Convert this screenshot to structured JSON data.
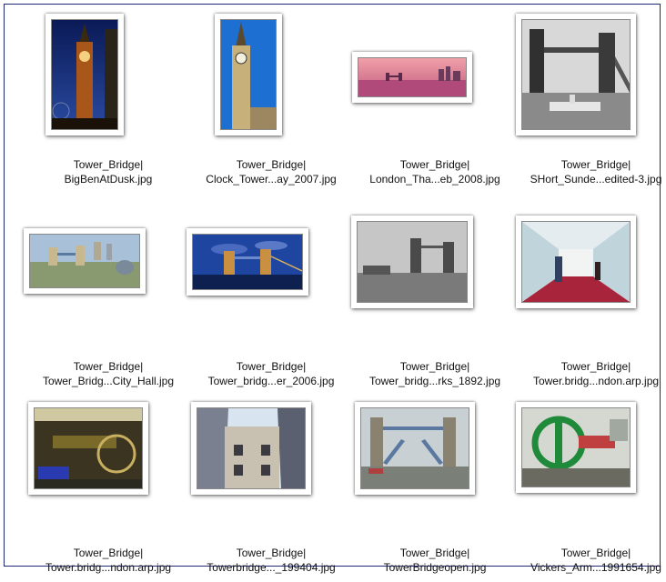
{
  "files": [
    {
      "line1": "Tower_Bridge|",
      "line2": "BigBenAtDusk.jpg",
      "icon": "big-ben-dusk-photo"
    },
    {
      "line1": "Tower_Bridge|",
      "line2": "Clock_Tower...ay_2007.jpg",
      "icon": "clock-tower-photo"
    },
    {
      "line1": "Tower_Bridge|",
      "line2": "London_Tha...eb_2008.jpg",
      "icon": "thames-sunset-photo"
    },
    {
      "line1": "Tower_Bridge|",
      "line2": "SHort_Sunde...edited-3.jpg",
      "icon": "bw-bridge-seaplane-photo"
    },
    {
      "line1": "Tower_Bridge|",
      "line2": "Tower_Bridg...City_Hall.jpg",
      "icon": "bridge-city-hall-photo"
    },
    {
      "line1": "Tower_Bridge|",
      "line2": "Tower_bridg...er_2006.jpg",
      "icon": "bridge-night-photo"
    },
    {
      "line1": "Tower_Bridge|",
      "line2": "Tower_bridg...rks_1892.jpg",
      "icon": "bridge-1892-photo"
    },
    {
      "line1": "Tower_Bridge|",
      "line2": "Tower.bridg...ndon.arp.jpg",
      "icon": "walkway-photo"
    },
    {
      "line1": "Tower_Bridge|",
      "line2": "Tower.bridg...ndon.arp.jpg",
      "icon": "engine-room-photo"
    },
    {
      "line1": "Tower_Bridge|",
      "line2": "Towerbridge..._199404.jpg",
      "icon": "tower-upward-photo"
    },
    {
      "line1": "Tower_Bridge|",
      "line2": "TowerBridgeopen.jpg",
      "icon": "bridge-open-photo"
    },
    {
      "line1": "Tower_Bridge|",
      "line2": "Vickers_Arm...1991654.jpg",
      "icon": "vickers-engine-photo"
    }
  ]
}
